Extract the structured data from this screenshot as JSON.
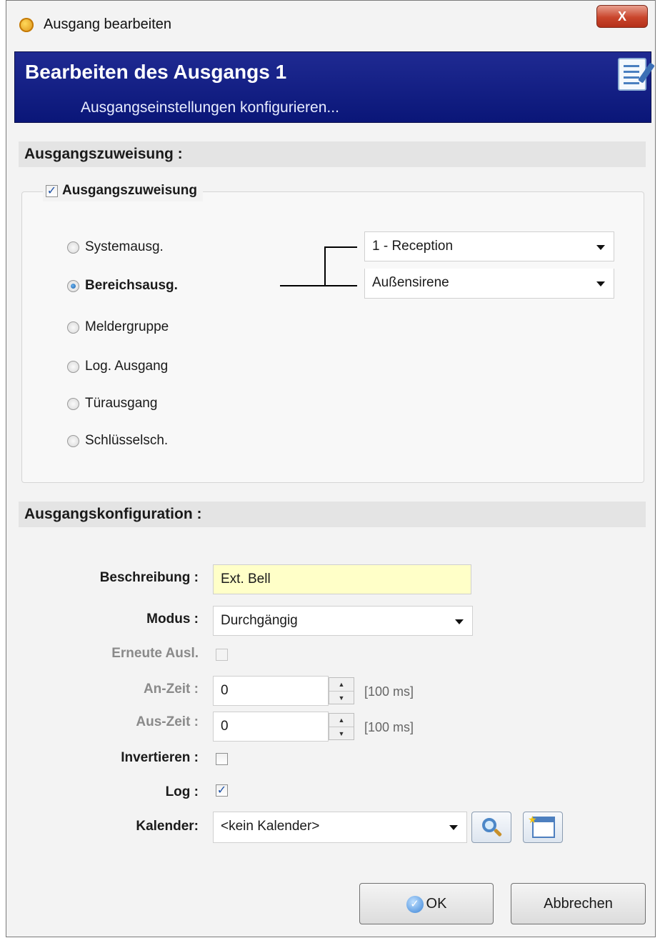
{
  "window": {
    "title": "Ausgang bearbeiten",
    "close_glyph": "X"
  },
  "banner": {
    "title": "Bearbeiten des Ausgangs 1",
    "subtitle": "Ausgangseinstellungen konfigurieren..."
  },
  "assignment": {
    "section_title": "Ausgangszuweisung :",
    "checkbox_label": "Ausgangszuweisung",
    "checkbox_checked": true,
    "options": [
      {
        "label": "Systemausg.",
        "selected": false
      },
      {
        "label": "Bereichsausg.",
        "selected": true
      },
      {
        "label": "Meldergruppe",
        "selected": false
      },
      {
        "label": "Log. Ausgang",
        "selected": false
      },
      {
        "label": "Türausgang",
        "selected": false
      },
      {
        "label": "Schlüsselsch.",
        "selected": false
      }
    ],
    "area_select": "1 - Reception",
    "output_select": "Außensirene"
  },
  "config": {
    "section_title": "Ausgangskonfiguration :",
    "description_label": "Beschreibung :",
    "description_value": "Ext. Bell",
    "mode_label": "Modus :",
    "mode_value": "Durchgängig",
    "retrigger_label": "Erneute Ausl.",
    "on_time_label": "An-Zeit :",
    "on_time_value": "0",
    "off_time_label": "Aus-Zeit :",
    "off_time_value": "0",
    "unit": "[100 ms]",
    "invert_label": "Invertieren :",
    "log_label": "Log :",
    "log_checked": true,
    "calendar_label": "Kalender:",
    "calendar_value": "<kein Kalender>"
  },
  "buttons": {
    "ok": "OK",
    "cancel": "Abbrechen"
  },
  "icons": {
    "app": "gear-icon",
    "close": "close-icon",
    "banner": "edit-document-icon",
    "search": "magnifier-icon",
    "calendar": "new-calendar-icon",
    "ok": "check-icon"
  },
  "colors": {
    "banner": "#0a1678",
    "description_bg": "#ffffc8",
    "close": "#c9452c"
  }
}
